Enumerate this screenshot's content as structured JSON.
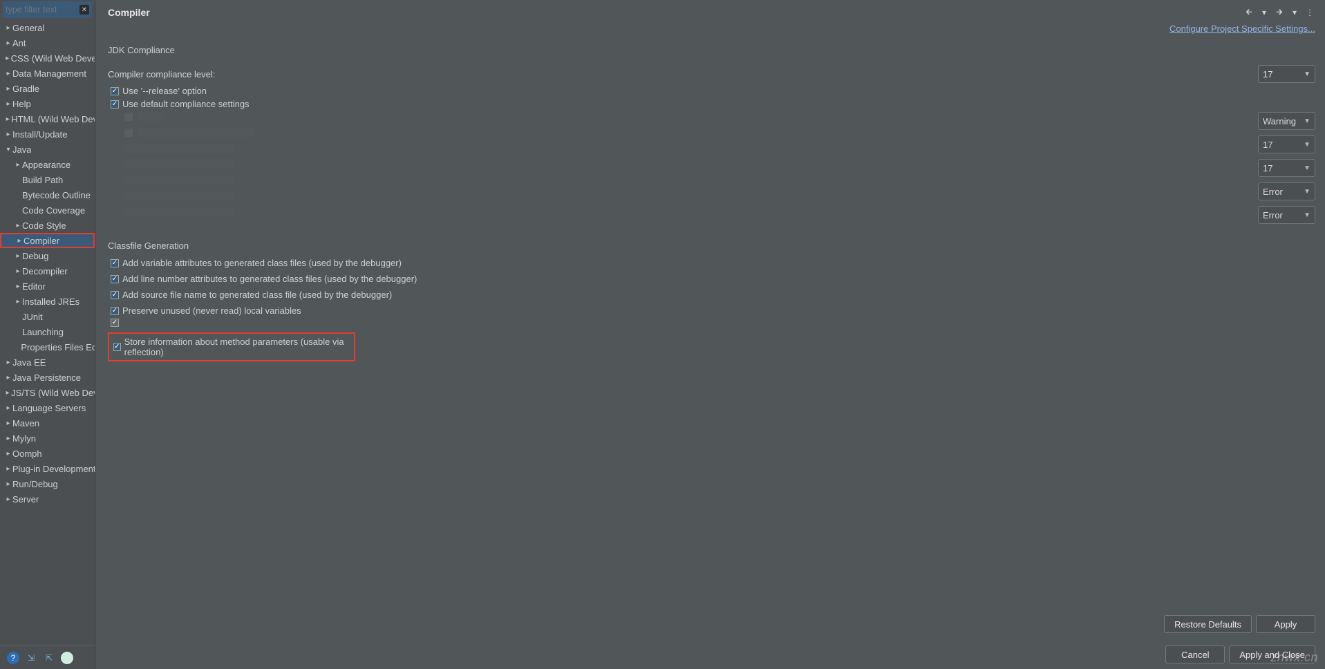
{
  "sidebar": {
    "filter_placeholder": "type filter text",
    "items": [
      {
        "label": "General",
        "arrow": "right",
        "indent": 0
      },
      {
        "label": "Ant",
        "arrow": "right",
        "indent": 0
      },
      {
        "label": "CSS (Wild Web Developm",
        "arrow": "right",
        "indent": 0
      },
      {
        "label": "Data Management",
        "arrow": "right",
        "indent": 0
      },
      {
        "label": "Gradle",
        "arrow": "right",
        "indent": 0
      },
      {
        "label": "Help",
        "arrow": "right",
        "indent": 0
      },
      {
        "label": "HTML (Wild Web Develo",
        "arrow": "right",
        "indent": 0
      },
      {
        "label": "Install/Update",
        "arrow": "right",
        "indent": 0
      },
      {
        "label": "Java",
        "arrow": "down",
        "indent": 0
      },
      {
        "label": "Appearance",
        "arrow": "right",
        "indent": 1
      },
      {
        "label": "Build Path",
        "arrow": "none",
        "indent": 1
      },
      {
        "label": "Bytecode Outline",
        "arrow": "none",
        "indent": 1
      },
      {
        "label": "Code Coverage",
        "arrow": "none",
        "indent": 1
      },
      {
        "label": "Code Style",
        "arrow": "right",
        "indent": 1
      },
      {
        "label": "Compiler",
        "arrow": "right",
        "indent": 1,
        "selected": true,
        "highlight": true
      },
      {
        "label": "Debug",
        "arrow": "right",
        "indent": 1
      },
      {
        "label": "Decompiler",
        "arrow": "right",
        "indent": 1
      },
      {
        "label": "Editor",
        "arrow": "right",
        "indent": 1
      },
      {
        "label": "Installed JREs",
        "arrow": "right",
        "indent": 1
      },
      {
        "label": "JUnit",
        "arrow": "none",
        "indent": 1
      },
      {
        "label": "Launching",
        "arrow": "none",
        "indent": 1
      },
      {
        "label": "Properties Files Edito",
        "arrow": "none",
        "indent": 1
      },
      {
        "label": "Java EE",
        "arrow": "right",
        "indent": 0
      },
      {
        "label": "Java Persistence",
        "arrow": "right",
        "indent": 0
      },
      {
        "label": "JS/TS (Wild Web Develo",
        "arrow": "right",
        "indent": 0
      },
      {
        "label": "Language Servers",
        "arrow": "right",
        "indent": 0
      },
      {
        "label": "Maven",
        "arrow": "right",
        "indent": 0
      },
      {
        "label": "Mylyn",
        "arrow": "right",
        "indent": 0
      },
      {
        "label": "Oomph",
        "arrow": "right",
        "indent": 0
      },
      {
        "label": "Plug-in Development",
        "arrow": "right",
        "indent": 0
      },
      {
        "label": "Run/Debug",
        "arrow": "right",
        "indent": 0
      },
      {
        "label": "Server",
        "arrow": "right",
        "indent": 0
      }
    ]
  },
  "header": {
    "title": "Compiler",
    "config_link": "Configure Project Specific Settings..."
  },
  "jdk": {
    "heading": "JDK Compliance",
    "compliance_label": "Compiler compliance level:",
    "compliance_value": "17",
    "release_option": "Use '--release' option",
    "default_settings": "Use default compliance settings"
  },
  "right_dropdowns": [
    {
      "value": "Warning"
    },
    {
      "value": "17"
    },
    {
      "value": "17"
    },
    {
      "value": "Error"
    },
    {
      "value": "Error"
    }
  ],
  "classfile": {
    "heading": "Classfile Generation",
    "checks": [
      "Add variable attributes to generated class files (used by the debugger)",
      "Add line number attributes to generated class files (used by the debugger)",
      "Add source file name to generated class file (used by the debugger)",
      "Preserve unused (never read) local variables"
    ],
    "blank_check": "",
    "highlight": "Store information about method parameters (usable via reflection)"
  },
  "buttons": {
    "restore": "Restore Defaults",
    "apply": "Apply",
    "cancel": "Cancel",
    "apply_close": "Apply and Close"
  },
  "watermark": "znwx.cn"
}
